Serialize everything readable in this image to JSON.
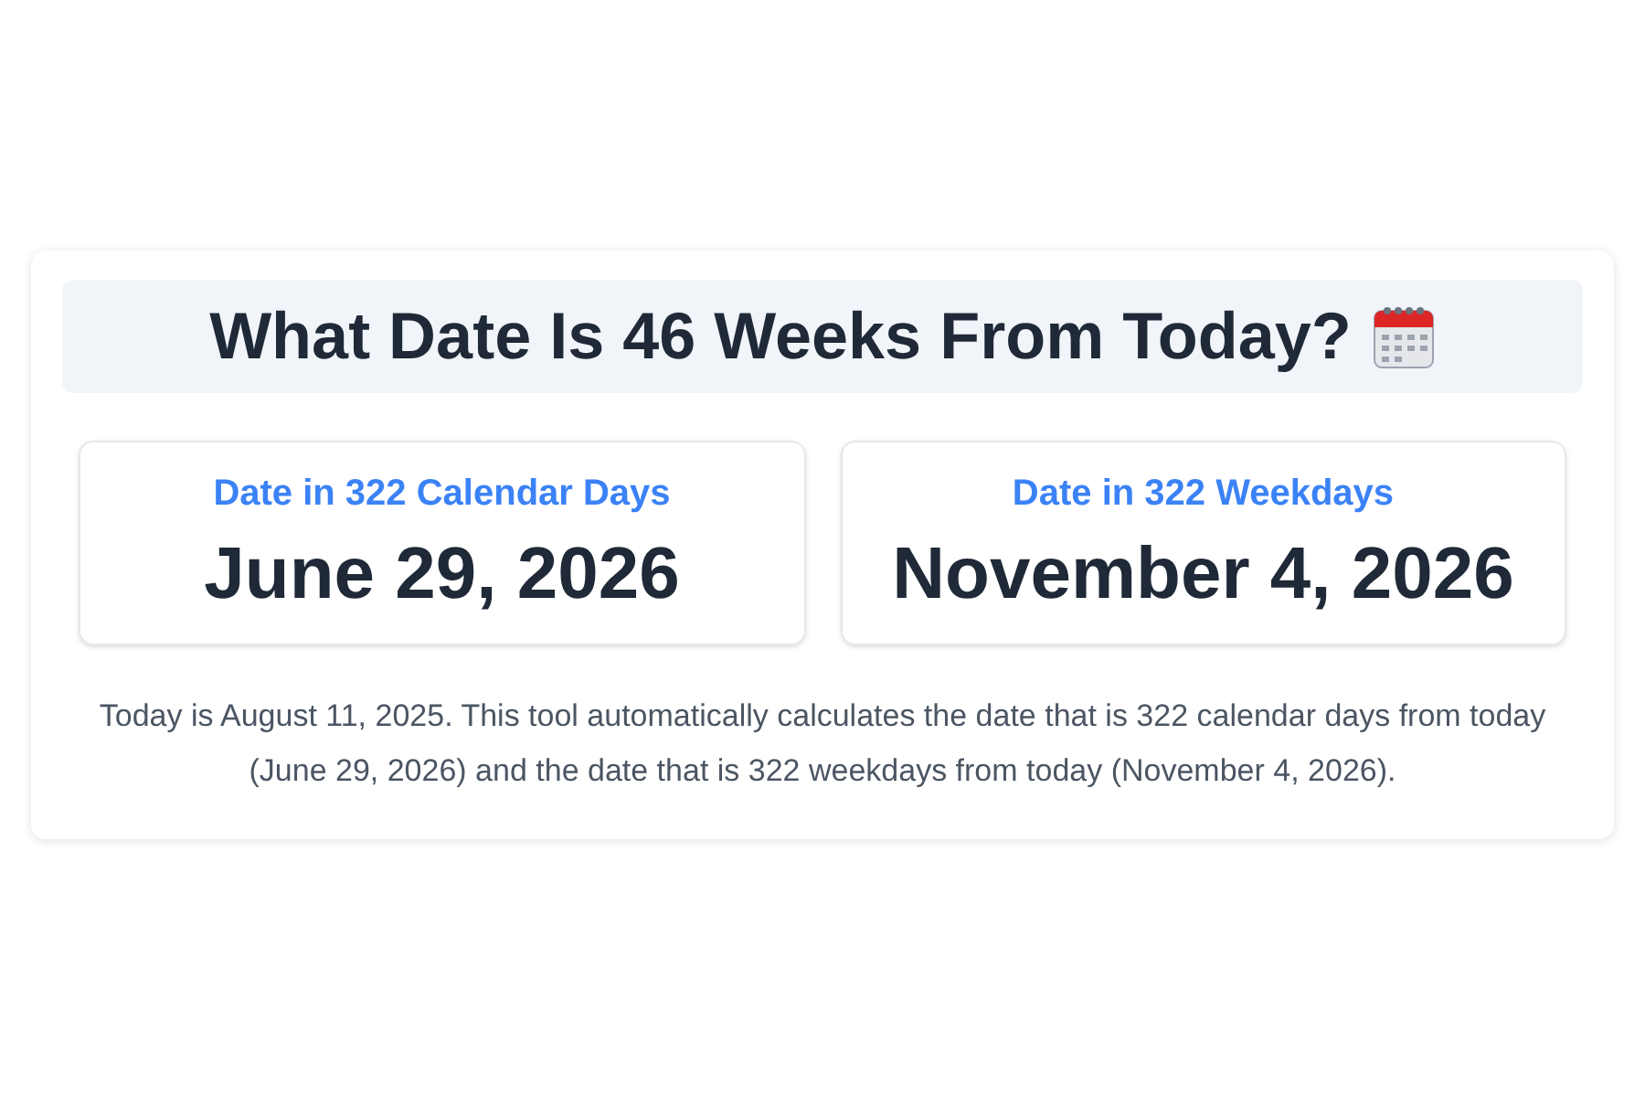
{
  "title": "What Date Is 46 Weeks From Today?",
  "results": [
    {
      "label": "Date in 322 Calendar Days",
      "value": "June 29, 2026"
    },
    {
      "label": "Date in 322 Weekdays",
      "value": "November 4, 2026"
    }
  ],
  "description": "Today is August 11, 2025. This tool automatically calculates the date that is 322 calendar days from today (June 29, 2026) and the date that is 322 weekdays from today (November 4, 2026)."
}
